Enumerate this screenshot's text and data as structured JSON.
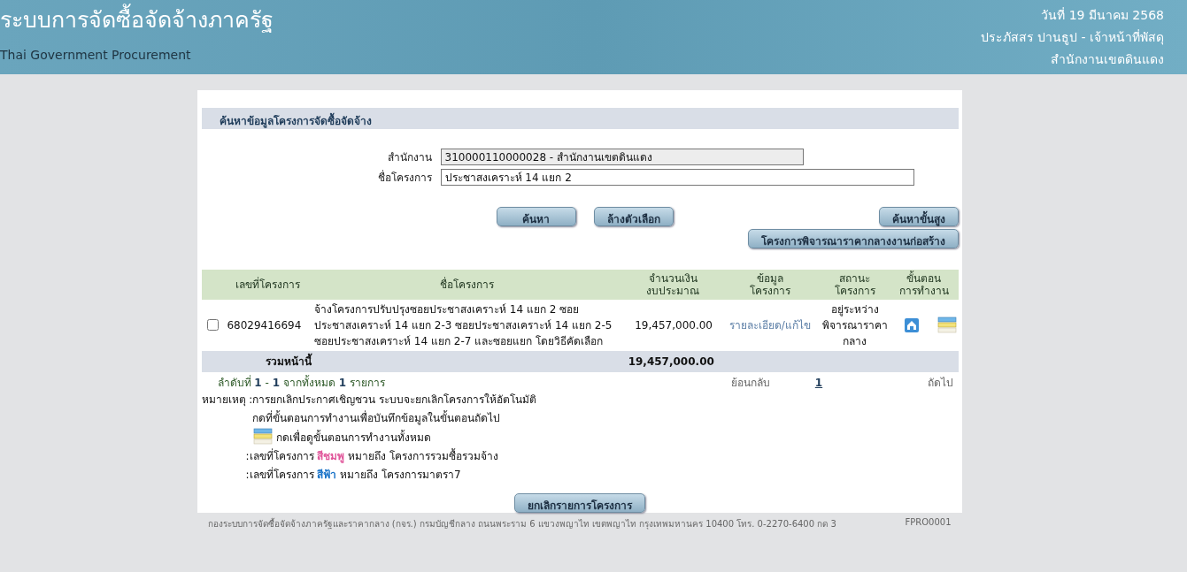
{
  "header": {
    "title": "ระบบการจัดซื้อจัดจ้างภาครัฐ",
    "subtitle": "Thai Government Procurement",
    "date": "วันที่ 19 มีนาคม 2568",
    "user": "ประภัสสร ปานธูป - เจ้าหน้าที่พัสดุ",
    "office": "สำนักงานเขตดินแดง"
  },
  "search": {
    "heading": "ค้นหาข้อมูลโครงการจัดซื้อจัดจ้าง",
    "fields": [
      {
        "label": "สำนักงาน",
        "value": "310000110000028 - สำนักงานเขตดินแดง",
        "readonly": true
      },
      {
        "label": "ชื่อโครงการ",
        "value": "ประชาสงเคราะห์ 14 แยก 2",
        "readonly": false
      }
    ],
    "buttons": [
      "ค้นหา",
      "ล้างตัวเลือก"
    ],
    "advanced_button": "ค้นหาขั้นสูง",
    "construction_button": "โครงการพิจารณาราคากลางงานก่อสร้าง"
  },
  "table": {
    "columns": [
      "เลขที่โครงการ",
      "ชื่อโครงการ",
      "จำนวนเงิน\nงบประมาณ",
      "ข้อมูล\nโครงการ",
      "สถานะ\nโครงการ",
      "ขั้นตอน\nการทำงาน"
    ],
    "rows": [
      {
        "checked": false,
        "project_no": "68029416694",
        "name": "จ้างโครงการปรับปรุงซอยประชาสงเคราะห์ 14 แยก 2 ซอย ประชาสงเคราะห์ 14 แยก 2-3 ซอยประชาสงเคราะห์ 14 แยก 2-5 ซอยประชาสงเคราะห์ 14 แยก 2-7 และซอยแยก โดยวิธีคัดเลือก",
        "budget": "19,457,000.00",
        "info_link": "รายละเอียด/แก้ไข",
        "status": "อยู่ระหว่าง พิจารณาราคา กลาง"
      }
    ],
    "total_label": "รวมหน้านี้",
    "total_value": "19,457,000.00"
  },
  "pagination": {
    "summary": "ลำดับที่ **1** - **1** จากทั้งหมด **1** รายการ",
    "prev": "ย้อนกลับ",
    "pages": [
      {
        "label": "1",
        "selected": true
      }
    ],
    "next": "ถัดไป"
  },
  "notes": {
    "label": "หมายเหตุ",
    "lines": [
      ":การยกเลิกประกาศเชิญชวน ระบบจะยกเลิกโครงการให้อัตโนมัติ",
      "กดที่ขั้นตอนการทำงานเพื่อบันทึกข้อมูลในขั้นตอนถัดไป"
    ],
    "icon_hint": "กดเพื่อดูขั้นตอนการทำงานทั้งหมด",
    "color_legend": [
      {
        "prefix": ":เลขที่โครงการ",
        "highlight": "สีชมพู",
        "color": "#e0559a",
        "suffix": "หมายถึง โครงการรวมซื้อรวมจ้าง"
      },
      {
        "prefix": ":เลขที่โครงการ",
        "highlight": "สีฟ้า",
        "color": "#1a73c8",
        "suffix": "หมายถึง โครงการมาตรา7"
      }
    ]
  },
  "cancel_button": "ยกเลิกรายการโครงการ",
  "footer": {
    "text": "กองระบบการจัดซื้อจัดจ้างภาครัฐและราคากลาง (กจร.) กรมบัญชีกลาง ถนนพระราม 6 แขวงพญาไท เขตพญาไท กรุงเทพมหานคร 10400 โทร. 0-2270-6400 กด 3",
    "code": "FPRO0001"
  }
}
